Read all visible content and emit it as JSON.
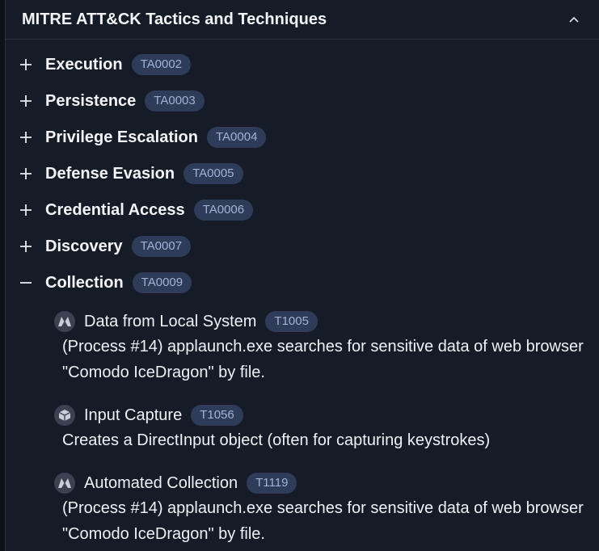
{
  "header": {
    "title": "MITRE ATT&CK Tactics and Techniques"
  },
  "tactics": [
    {
      "name": "Execution",
      "id": "TA0002",
      "expanded": false
    },
    {
      "name": "Persistence",
      "id": "TA0003",
      "expanded": false
    },
    {
      "name": "Privilege Escalation",
      "id": "TA0004",
      "expanded": false
    },
    {
      "name": "Defense Evasion",
      "id": "TA0005",
      "expanded": false
    },
    {
      "name": "Credential Access",
      "id": "TA0006",
      "expanded": false
    },
    {
      "name": "Discovery",
      "id": "TA0007",
      "expanded": false
    },
    {
      "name": "Collection",
      "id": "TA0009",
      "expanded": true
    }
  ],
  "techniques": [
    {
      "name": "Data from Local System",
      "id": "T1005",
      "icon": "malware-hex-icon",
      "desc_line1": "(Process #14) applaunch.exe searches for sensitive data of web browser",
      "desc_line2": "\"Comodo IceDragon\" by file."
    },
    {
      "name": "Input Capture",
      "id": "T1056",
      "icon": "cube-icon",
      "desc_line1": "Creates a DirectInput object (often for capturing keystrokes)",
      "desc_line2": ""
    },
    {
      "name": "Automated Collection",
      "id": "T1119",
      "icon": "malware-hex-icon",
      "desc_line1": "(Process #14) applaunch.exe searches for sensitive data of web browser",
      "desc_line2": "\"Comodo IceDragon\" by file."
    }
  ]
}
